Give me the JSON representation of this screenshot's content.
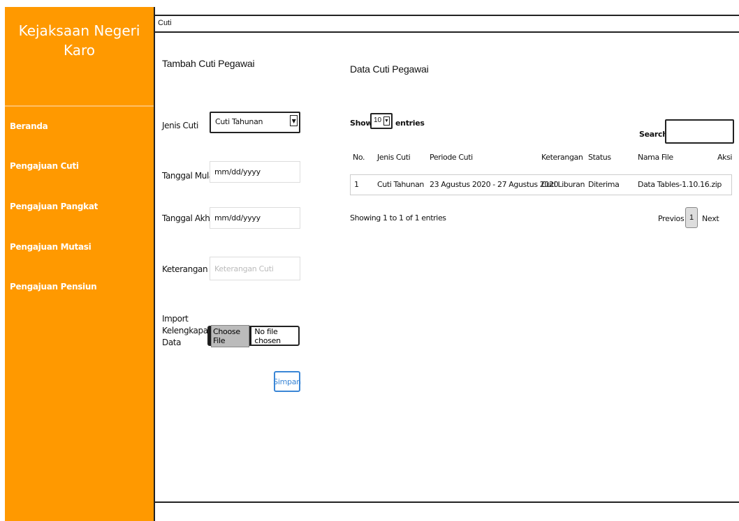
{
  "sidebar": {
    "brand": "Kejaksaan Negeri Karo",
    "items": [
      {
        "label": "Beranda"
      },
      {
        "label": "Pengajuan Cuti"
      },
      {
        "label": "Pengajuan Pangkat"
      },
      {
        "label": "Pengajuan Mutasi"
      },
      {
        "label": "Pengajuan Pensiun"
      }
    ]
  },
  "topbar": {
    "title": "Cuti"
  },
  "form": {
    "heading": "Tambah Cuti Pegawai",
    "jenis_cuti": {
      "label": "Jenis Cuti",
      "value": "Cuti Tahunan"
    },
    "tanggal_mulai": {
      "label": "Tanggal Mulai",
      "value": "mm/dd/yyyy"
    },
    "tanggal_akhir": {
      "label": "Tanggal Akhir",
      "value": "mm/dd/yyyy"
    },
    "keterangan": {
      "label": "Keterangan",
      "placeholder": "Keterangan Cuti"
    },
    "import": {
      "label_lines": [
        "Import",
        "Kelengkapan",
        "Data"
      ],
      "button": "Choose File",
      "status": "No file chosen"
    },
    "submit": "Simpan"
  },
  "table": {
    "heading": "Data Cuti Pegawai",
    "show_label": "Show",
    "entries_label": "entries",
    "page_length": "10",
    "search_label": "Search:",
    "columns": [
      "No.",
      "Jenis Cuti",
      "Periode Cuti",
      "Keterangan",
      "Status",
      "Nama File",
      "Aksi"
    ],
    "rows": [
      [
        "1",
        "Cuti Tahunan",
        "23 Agustus 2020 - 27 Agustus 2020",
        "Cuti Liburan",
        "Diterima",
        "Data Tables-1.10.16.zip",
        ""
      ]
    ],
    "info": "Showing 1 to 1 of 1 entries",
    "pagination": {
      "previous": "Previos",
      "current": "1",
      "next": "Next"
    }
  },
  "colors": {
    "sidebar": "#ff9900",
    "accent": "#3a86d6"
  }
}
